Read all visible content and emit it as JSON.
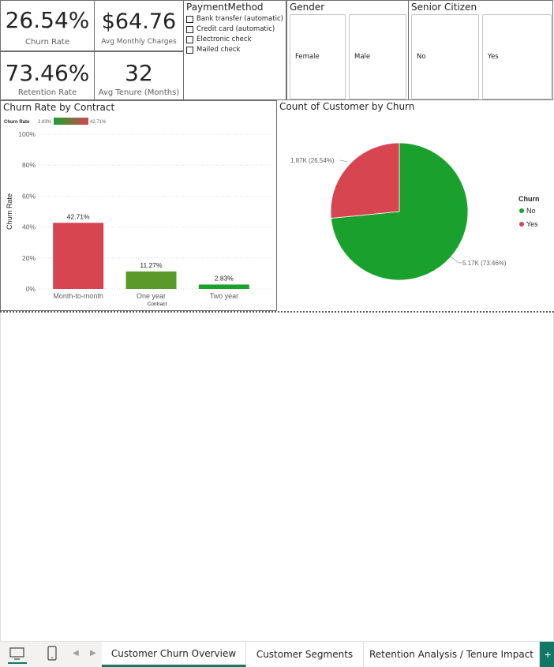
{
  "kpis": {
    "churn_rate": {
      "value": "26.54%",
      "label": "Churn Rate"
    },
    "avg_monthly_charges": {
      "value": "$64.76",
      "label": "Avg Monthly Charges"
    },
    "retention_rate": {
      "value": "73.46%",
      "label": "Retention Rate"
    },
    "avg_tenure": {
      "value": "32",
      "label": "Avg Tenure (Months)"
    }
  },
  "payment_slicer": {
    "title": "PaymentMethod",
    "items": [
      "Bank transfer (automatic)",
      "Credit card (automatic)",
      "Electronic check",
      "Mailed check"
    ]
  },
  "gender_slicer": {
    "title": "Gender",
    "items": [
      "Female",
      "Male"
    ]
  },
  "senior_slicer": {
    "title": "Senior Citizen",
    "items": [
      "No",
      "Yes"
    ]
  },
  "bar_visual": {
    "title": "Churn Rate by Contract",
    "legend_title": "Churn Rate",
    "legend_min": "2.83%",
    "legend_max": "42.71%"
  },
  "pie_visual": {
    "title": "Count of Customer by Churn",
    "legend_title": "Churn",
    "yes_label": "1.87K (26.54%)",
    "no_label": "5.17K (73.46%)"
  },
  "colors": {
    "red": "#d64550",
    "green": "#1aa12d",
    "olive": "#5a9a2a",
    "accent": "#117865"
  },
  "chart_data": [
    {
      "type": "bar",
      "title": "Churn Rate by Contract",
      "xlabel": "Contract",
      "ylabel": "Churn Rate",
      "categories": [
        "Month-to-month",
        "One year",
        "Two year"
      ],
      "values": [
        42.71,
        11.27,
        2.83
      ],
      "value_labels": [
        "42.71%",
        "11.27%",
        "2.83%"
      ],
      "colors": [
        "#d64550",
        "#5a9a2a",
        "#1aa12d"
      ],
      "yticks": [
        "0%",
        "20%",
        "40%",
        "60%",
        "80%",
        "100%"
      ],
      "ylim": [
        0,
        100
      ],
      "grid": true
    },
    {
      "type": "pie",
      "title": "Count of Customer by Churn",
      "slices": [
        {
          "name": "No",
          "value": 5170,
          "percent": 73.46,
          "color": "#1aa12d"
        },
        {
          "name": "Yes",
          "value": 1870,
          "percent": 26.54,
          "color": "#d64550"
        }
      ],
      "legend": "right"
    }
  ],
  "tabs": [
    "Customer Churn Overview",
    "Customer Segments",
    "Retention Analysis / Tenure Impact"
  ]
}
